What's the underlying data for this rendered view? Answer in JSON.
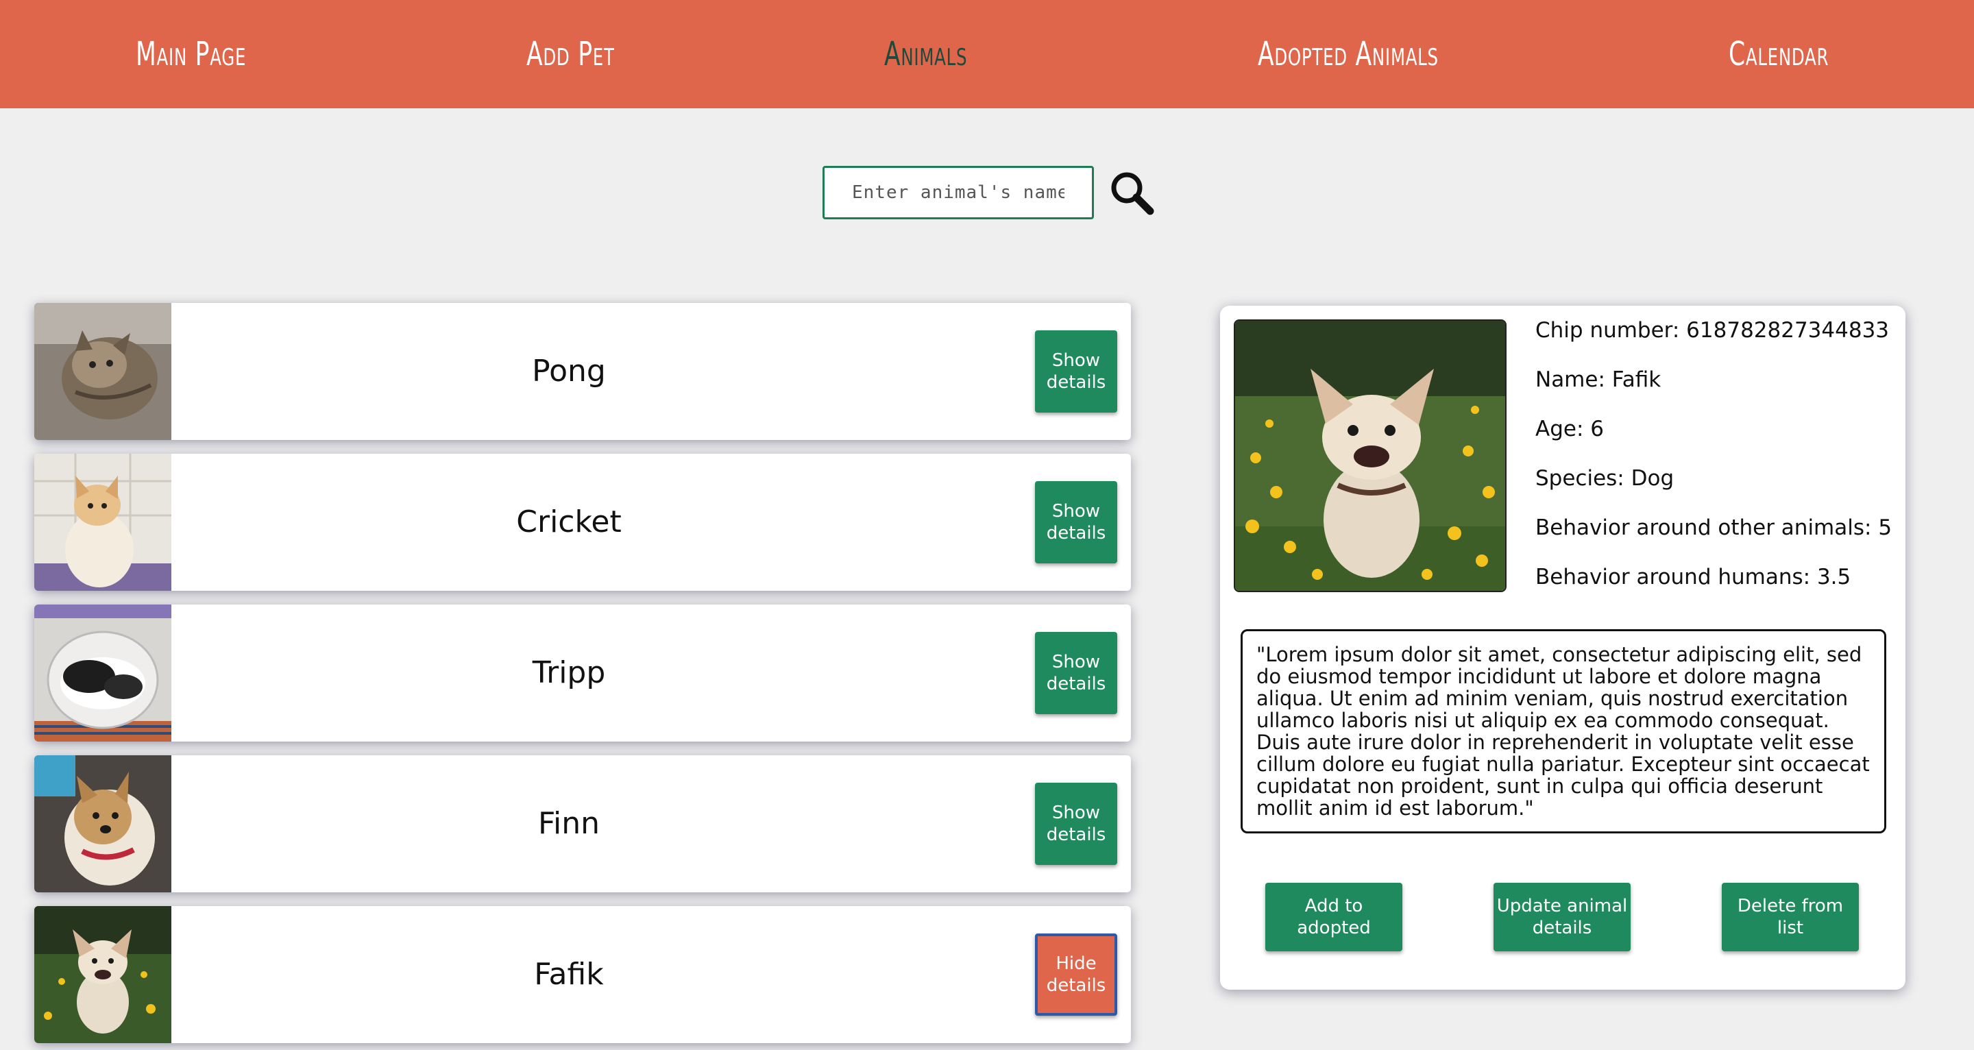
{
  "nav": {
    "items": [
      "Main Page",
      "Add Pet",
      "Animals",
      "Adopted Animals",
      "Calendar"
    ],
    "active": "Animals",
    "colors": {
      "bar": "#df654b",
      "text": "#ffffff",
      "active_text": "#1f4a3b"
    }
  },
  "search": {
    "placeholder": "Enter animal's name",
    "value": "",
    "icon": "search-icon"
  },
  "animals": [
    {
      "name": "Pong",
      "button": "Show details",
      "thumbnail": "tabby cat"
    },
    {
      "name": "Cricket",
      "button": "Show details",
      "thumbnail": "orange and white cat"
    },
    {
      "name": "Tripp",
      "button": "Show details",
      "thumbnail": "black and white cat"
    },
    {
      "name": "Finn",
      "button": "Show details",
      "thumbnail": "dog with red collar"
    },
    {
      "name": "Fafik",
      "button": "Hide details",
      "thumbnail": "chihuahua in meadow"
    }
  ],
  "details": {
    "chip": "Chip number: 618782827344833",
    "name": "Name: Fafik",
    "age": "Age: 6",
    "species": "Species: Dog",
    "behavior_animals": "Behavior around other animals: 5",
    "behavior_humans": "Behavior around humans: 3.5",
    "description": "\"Lorem ipsum dolor sit amet, consectetur adipiscing elit, sed do eiusmod tempor incididunt ut labore et dolore magna aliqua. Ut enim ad minim veniam, quis nostrud exercitation ullamco laboris nisi ut aliquip ex ea commodo consequat. Duis aute irure dolor in reprehenderit in voluptate velit esse cillum dolore eu fugiat nulla pariatur. Excepteur sint occaecat cupidatat non proident, sunt in culpa qui officia deserunt mollit anim id est laborum.\"",
    "buttons": {
      "add": "Add to adopted",
      "update": "Update animal details",
      "delete": "Delete from list"
    }
  },
  "colors": {
    "primary_button": "#1f8a5e",
    "hide_button": "#df654b",
    "background": "#efefef"
  }
}
